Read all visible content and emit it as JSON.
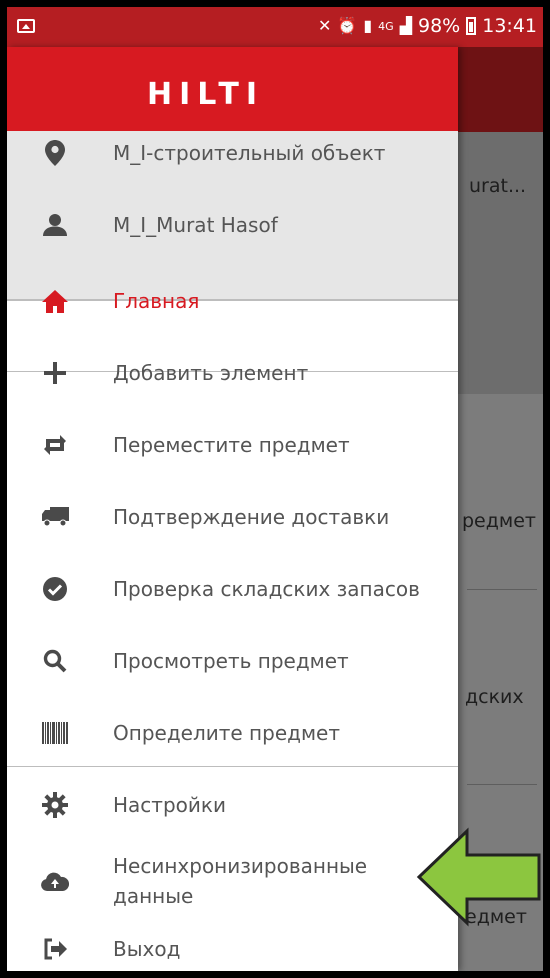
{
  "status_bar": {
    "battery": "98%",
    "time": "13:41",
    "network": "4G"
  },
  "header": {
    "logo": "HILTI"
  },
  "user_info": {
    "site": "M_I-строительный объект",
    "user": "M_I_Murat Hasof"
  },
  "menu": {
    "home": "Главная",
    "add_item": "Добавить элемент",
    "move_item": "Переместите предмет",
    "delivery_confirm": "Подтверждение доставки",
    "stock_check": "Проверка складских запасов",
    "view_item": "Просмотреть предмет",
    "identify_item": "Определите предмет",
    "settings": "Настройки",
    "unsynced": "Несинхронизированные\nданные",
    "logout": "Выход"
  },
  "background": {
    "text1": "urat...",
    "text2": "редмет",
    "text3": "дских",
    "text4": "едмет"
  },
  "colors": {
    "accent": "#d71a21",
    "status_bar": "#b51e22",
    "annotation_arrow": "#8cc63f"
  }
}
